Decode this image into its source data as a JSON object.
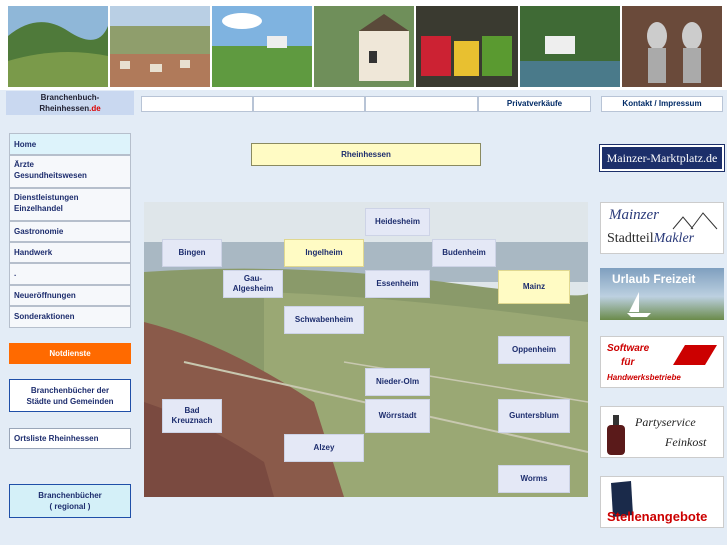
{
  "brand": {
    "line1": "Branchenbuch-",
    "line2": "Rheinhessen",
    "tld": ".de"
  },
  "topnav": [
    "",
    "",
    "",
    "Privatverkäufe"
  ],
  "contact": "Kontakt / Impressum",
  "sidebar": {
    "items": [
      {
        "label": "Home",
        "line2": ""
      },
      {
        "label": "Ärzte",
        "line2": "Gesundheitswesen"
      },
      {
        "label": "Dienstleistungen",
        "line2": "Einzelhandel"
      },
      {
        "label": "Gastronomie",
        "line2": ""
      },
      {
        "label": "Handwerk",
        "line2": ""
      },
      {
        "label": ".",
        "line2": ""
      },
      {
        "label": "Neueröffnungen",
        "line2": ""
      },
      {
        "label": "Sonderaktionen",
        "line2": ""
      }
    ],
    "notdienste": "Notdienste",
    "staedte": {
      "line1": "Branchenbücher der",
      "line2": "Städte und Gemeinden"
    },
    "ortsliste": "Ortsliste Rheinhessen",
    "regional": {
      "line1": "Branchenbücher",
      "line2": "( regional )"
    }
  },
  "main": {
    "title": "Rheinhessen"
  },
  "towns": {
    "bingen": "Bingen",
    "ingelheim": "Ingelheim",
    "heidesheim": "Heidesheim",
    "budenheim": "Budenheim",
    "gau1": "Gau-",
    "gau2": "Algesheim",
    "essenheim": "Essenheim",
    "mainz": "Mainz",
    "schwabenheim": "Schwabenheim",
    "oppenheim": "Oppenheim",
    "niederolm": "Nieder-Olm",
    "woerrstadt": "Wörrstadt",
    "bad1": "Bad",
    "bad2": "Kreuznach",
    "guntersblum": "Guntersblum",
    "alzey": "Alzey",
    "worms": "Worms"
  },
  "ads": {
    "marktplatz": "Mainzer-Marktplatz.de",
    "makler1": "Mainzer",
    "makler2": "Stadtteil",
    "makler3": "Makler",
    "urlaub": "Urlaub Freizeit",
    "software1": "Software",
    "software2": "für",
    "software3": "Handwerksbetriebe",
    "party1": "Partyservice",
    "party2": "Feinkost",
    "stellen": "Stellenangebote"
  },
  "colors": {
    "accent": "#ff6a00",
    "nav": "#1d2d6e",
    "highlight": "#fffbc4"
  }
}
